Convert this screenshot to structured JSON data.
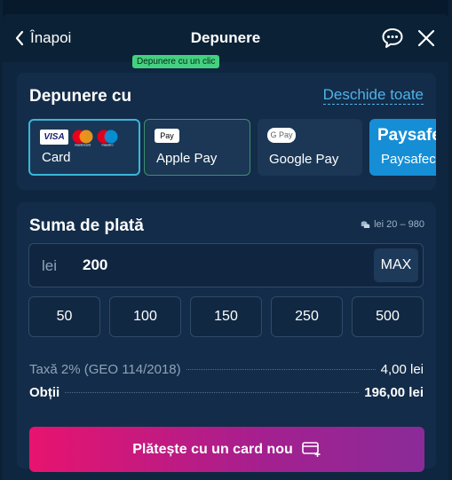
{
  "header": {
    "back_label": "Înapoi",
    "title": "Depunere"
  },
  "methods": {
    "title": "Depunere cu",
    "open_all": "Deschide toate",
    "badge": "Depunere cu un clic",
    "items": [
      {
        "label": "Card",
        "logos": [
          "VISA",
          "mastercard",
          "maestro"
        ]
      },
      {
        "label": "Apple Pay",
        "logo": "Pay"
      },
      {
        "label": "Google Pay",
        "logo": "G Pay"
      },
      {
        "label": "Paysafecard",
        "logo": "Paysafec"
      }
    ]
  },
  "amount": {
    "title": "Suma de plată",
    "range": "lei 20 – 980",
    "currency": "lei",
    "value": "200",
    "max_label": "MAX",
    "presets": [
      "50",
      "100",
      "150",
      "250",
      "500"
    ],
    "fee_label": "Taxă 2% (GEO 114/2018)",
    "fee_value": "4,00 lei",
    "total_label": "Obții",
    "total_value": "196,00 lei",
    "pay_label": "Plătește cu un card nou"
  },
  "colors": {
    "accent": "#3ab7d8",
    "link": "#4fb3e8",
    "badge": "#43d07f",
    "pay_gradient_start": "#e8136f",
    "pay_gradient_end": "#8a2b98"
  }
}
